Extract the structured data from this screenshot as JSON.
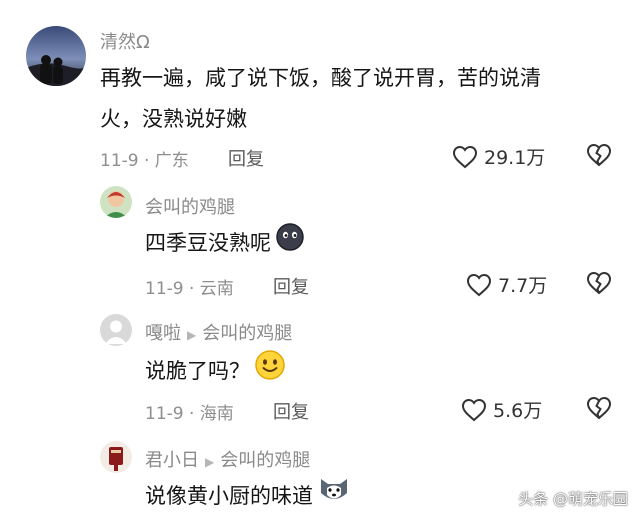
{
  "comments": [
    {
      "username": "清然Ω",
      "text_line1": "再教一遍，咸了说下饭，酸了说开胃，苦的说清",
      "text_line2": "火，没熟说好嫩",
      "meta": "11-9 · 广东",
      "reply_label": "回复",
      "likes": "29.1万"
    },
    {
      "username": "会叫的鸡腿",
      "text": "四季豆没熟呢",
      "meta": "11-9 · 云南",
      "reply_label": "回复",
      "likes": "7.7万"
    },
    {
      "username": "嘎啦",
      "reply_to": "会叫的鸡腿",
      "text": "说脆了吗？",
      "meta": "11-9 · 海南",
      "reply_label": "回复",
      "likes": "5.6万"
    },
    {
      "username": "君小日",
      "reply_to": "会叫的鸡腿",
      "text": "说像黄小厨的味道"
    }
  ],
  "watermark": "头条 @萌宠乐园",
  "colors": {
    "meta": "#8e8e8e",
    "username": "#8a8a8a",
    "text": "#161616"
  }
}
